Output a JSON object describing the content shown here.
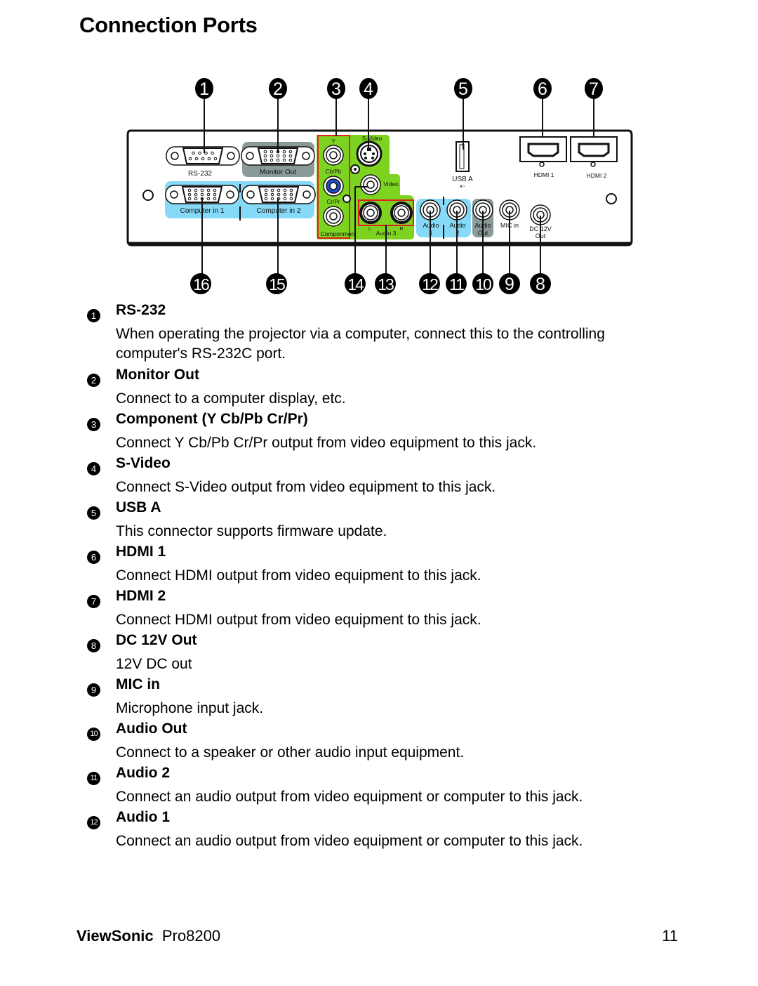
{
  "page": {
    "title": "Connection Ports"
  },
  "diagram": {
    "callouts_top": [
      "1",
      "2",
      "3",
      "4",
      "5",
      "6",
      "7"
    ],
    "callouts_bottom": [
      "16",
      "15",
      "14",
      "13",
      "12",
      "11",
      "10",
      "9",
      "8"
    ],
    "port_labels": {
      "rs232": "RS-232",
      "monitor_out": "Monitor Out",
      "computer_in_1": "Computer in 1",
      "computer_in_2": "Computer in 2",
      "y": "Y",
      "cb_pb": "Cb/Pb",
      "cr_pr": "Cr/Pr",
      "component": "Componment",
      "s_video": "S-Video",
      "video": "Video",
      "audio3_l": "L",
      "audio3_r": "R",
      "audio3": "Audio 3",
      "usb_a": "USB A",
      "audio1_a": "Audio",
      "audio1_b": "1",
      "audio2_a": "Audio",
      "audio2_b": "2",
      "audio_out_a": "Audio",
      "audio_out_b": "Out",
      "mic_in": "MIC in",
      "dc12v_a": "DC 12V",
      "dc12v_b": "Out",
      "hdmi1": "HDMI 1",
      "hdmi2": "HDMI 2"
    },
    "colors": {
      "component_green": "#7ed321",
      "computer_blue": "#86d9f7",
      "monitor_gray": "#8a9a98",
      "component_border_red": "#e02020",
      "cb_blue": "#1e4fd6"
    }
  },
  "items": [
    {
      "num": "1",
      "name": "RS-232",
      "desc": "When operating the projector via a computer, connect this to the controlling computer's RS-232C port."
    },
    {
      "num": "2",
      "name": "Monitor Out",
      "desc": "Connect to a computer display, etc."
    },
    {
      "num": "3",
      "name": "Component (Y Cb/Pb Cr/Pr)",
      "desc": "Connect Y Cb/Pb Cr/Pr output from video equipment to this jack."
    },
    {
      "num": "4",
      "name": "S-Video",
      "desc": "Connect S-Video output from video equipment to this jack."
    },
    {
      "num": "5",
      "name": "USB A",
      "desc": "This connector supports firmware update."
    },
    {
      "num": "6",
      "name": "HDMI 1",
      "desc": "Connect HDMI output from video equipment to this jack."
    },
    {
      "num": "7",
      "name": "HDMI 2",
      "desc": "Connect HDMI output from video equipment to this jack."
    },
    {
      "num": "8",
      "name": "DC 12V Out",
      "desc": "12V DC out"
    },
    {
      "num": "9",
      "name": "MIC in",
      "desc": "Microphone input jack."
    },
    {
      "num": "10",
      "name": "Audio Out",
      "desc": "Connect to a speaker or other audio input equipment."
    },
    {
      "num": "11",
      "name": "Audio 2",
      "desc": "Connect an audio output from video equipment or computer to this jack."
    },
    {
      "num": "12",
      "name": "Audio 1",
      "desc": "Connect an audio output from video equipment or computer to this jack."
    }
  ],
  "footer": {
    "brand": "ViewSonic",
    "model": "Pro8200",
    "page_number": "11"
  }
}
